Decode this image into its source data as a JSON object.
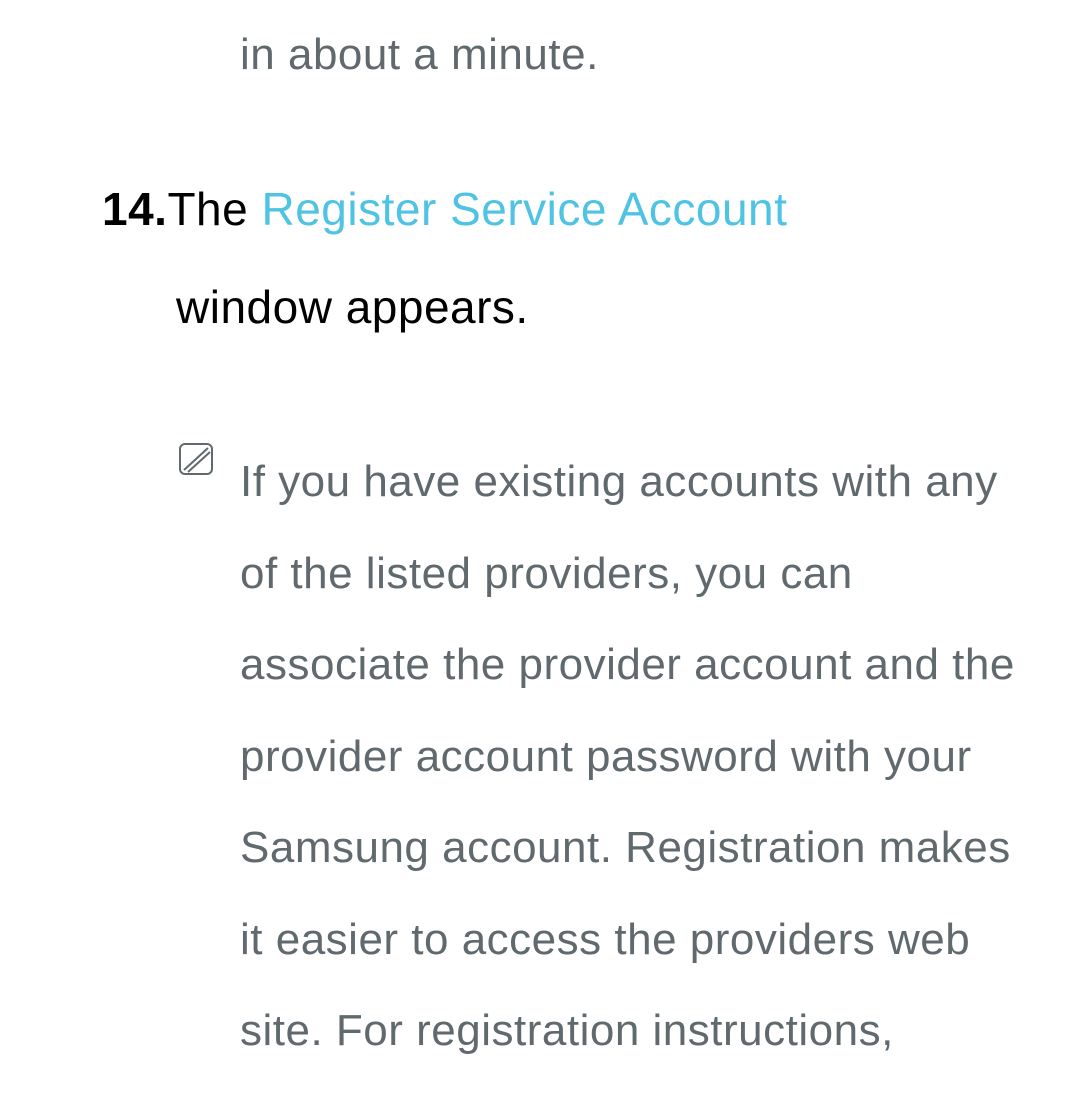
{
  "fragment_top": "in about a minute.",
  "step": {
    "number": "14.",
    "text_start": "The ",
    "link": "Register Service Account",
    "text_end": " window appears."
  },
  "note": {
    "text": "If you have existing accounts with any of the listed providers, you can associate the provider account and the provider account password with your Samsung account. Registration makes it easier to access the providers web site. For registration instructions,"
  }
}
